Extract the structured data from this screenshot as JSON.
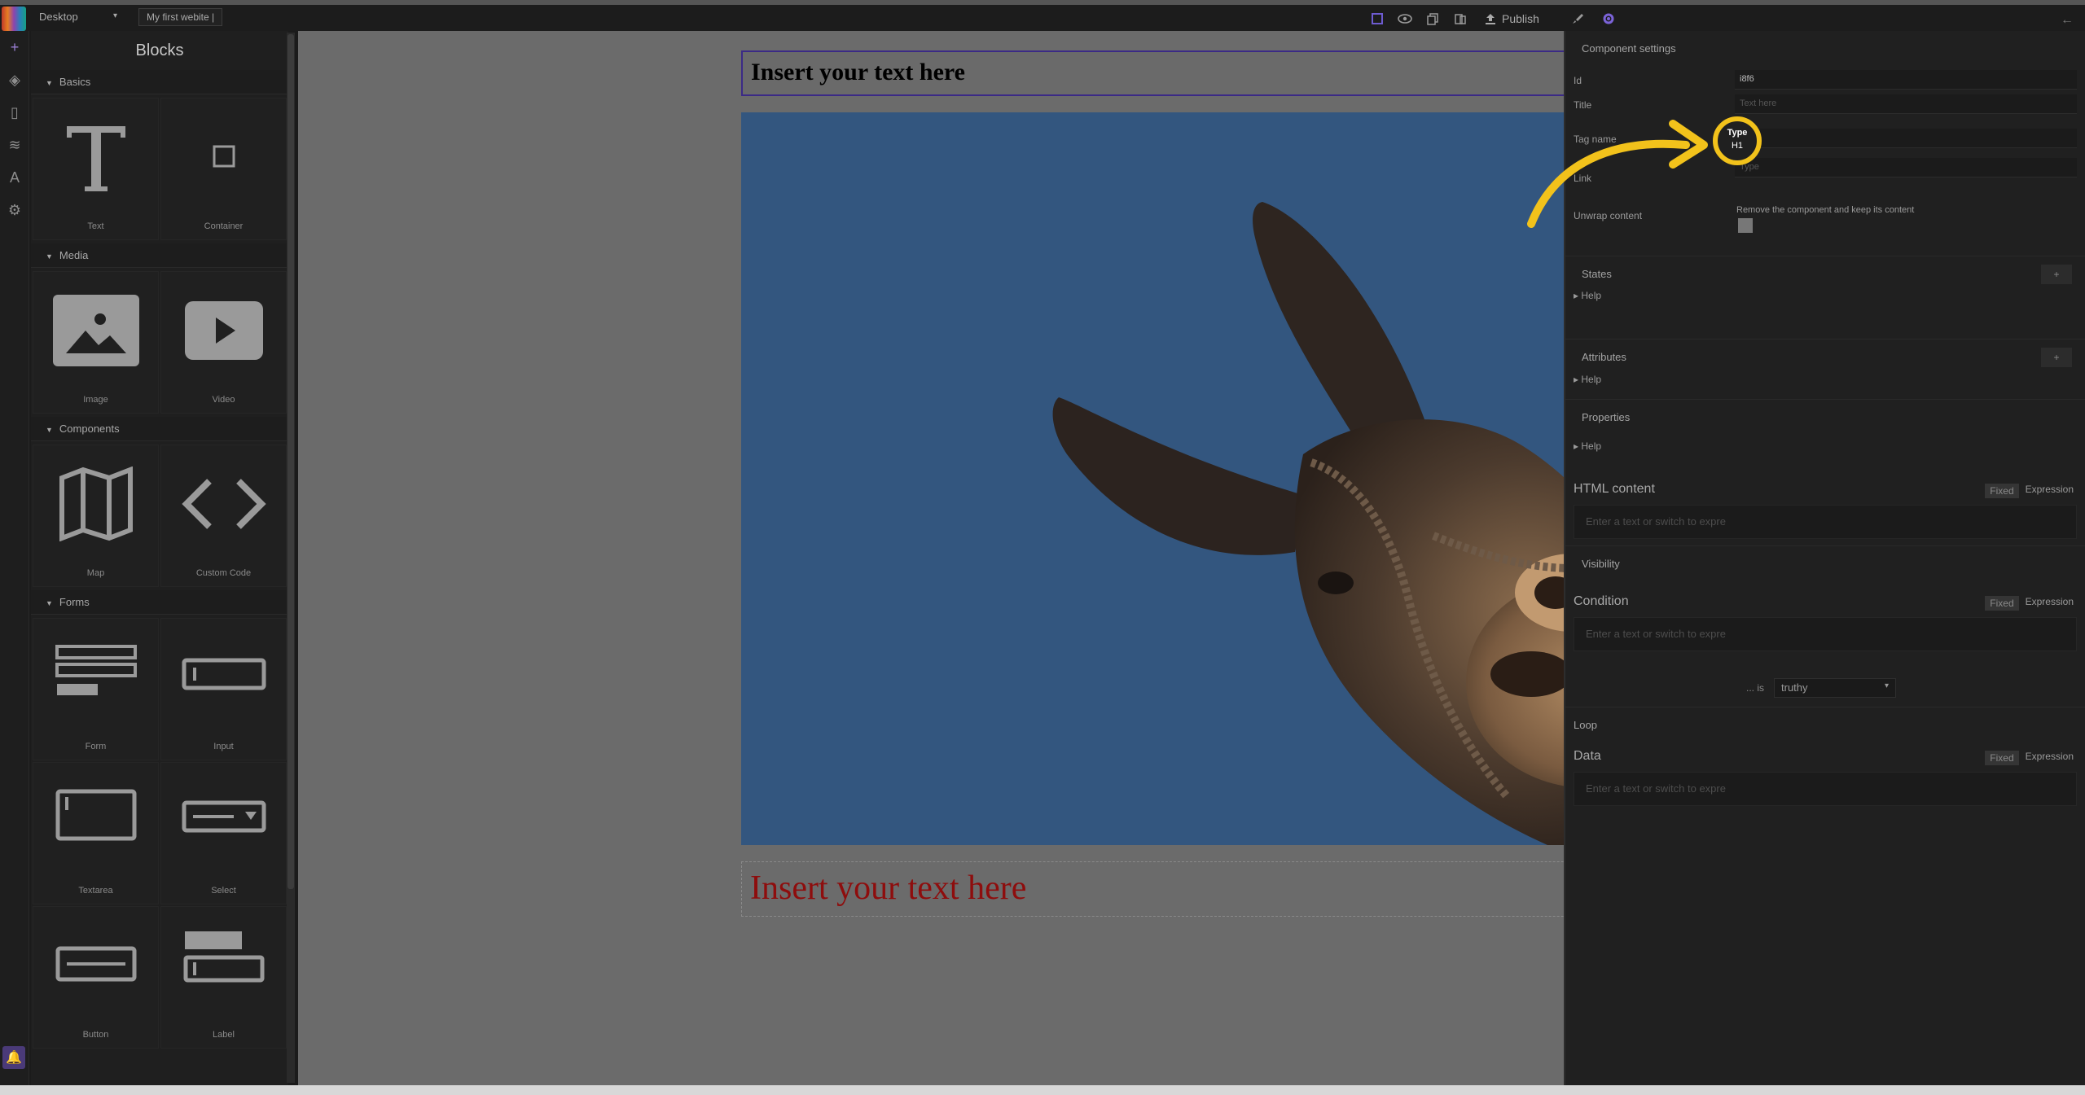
{
  "topbar": {
    "device": "Desktop",
    "site_name": "My first webite |",
    "publish_label": "Publish"
  },
  "icons": {
    "rail": [
      "plus-icon",
      "paint-bucket-icon",
      "page-icon",
      "layers-icon",
      "font-icon",
      "settings-icon"
    ],
    "bell": "bell-icon"
  },
  "blocks_panel": {
    "title": "Blocks",
    "categories": [
      {
        "name": "Basics",
        "items": [
          "Text",
          "Container"
        ]
      },
      {
        "name": "Media",
        "items": [
          "Image",
          "Video"
        ]
      },
      {
        "name": "Components",
        "items": [
          "Map",
          "Custom Code"
        ]
      },
      {
        "name": "Forms",
        "items": [
          "Form",
          "Input",
          "Textarea",
          "Select",
          "Button",
          "Label"
        ]
      }
    ]
  },
  "canvas": {
    "heading1": "Insert your text here",
    "heading2": "Insert your text here"
  },
  "settings": {
    "title": "Component settings",
    "id_label": "Id",
    "id_value": "i8f6",
    "title_label": "Title",
    "title_placeholder": "Text here",
    "tag_label": "Tag name",
    "link_label": "Link",
    "link_placeholder": "Type",
    "unwrap_label": "Unwrap content",
    "unwrap_help": "Remove the component and keep its content",
    "states": "States",
    "attributes": "Attributes",
    "properties": "Properties",
    "help": "Help",
    "plus": "+",
    "html_content": "HTML content",
    "fixed": "Fixed",
    "expression": "Expression",
    "textarea_placeholder": "Enter a text or switch to expre",
    "visibility": "Visibility",
    "condition": "Condition",
    "is_label": "... is",
    "truthy": "truthy",
    "loop": "Loop",
    "data": "Data"
  },
  "tooltip": {
    "label": "Type",
    "value": "H1",
    "color": "#f2c21b"
  },
  "colors": {
    "accent": "#5d4b9c",
    "heading2": "#8e0d0d",
    "image_bg": "#33567f"
  }
}
